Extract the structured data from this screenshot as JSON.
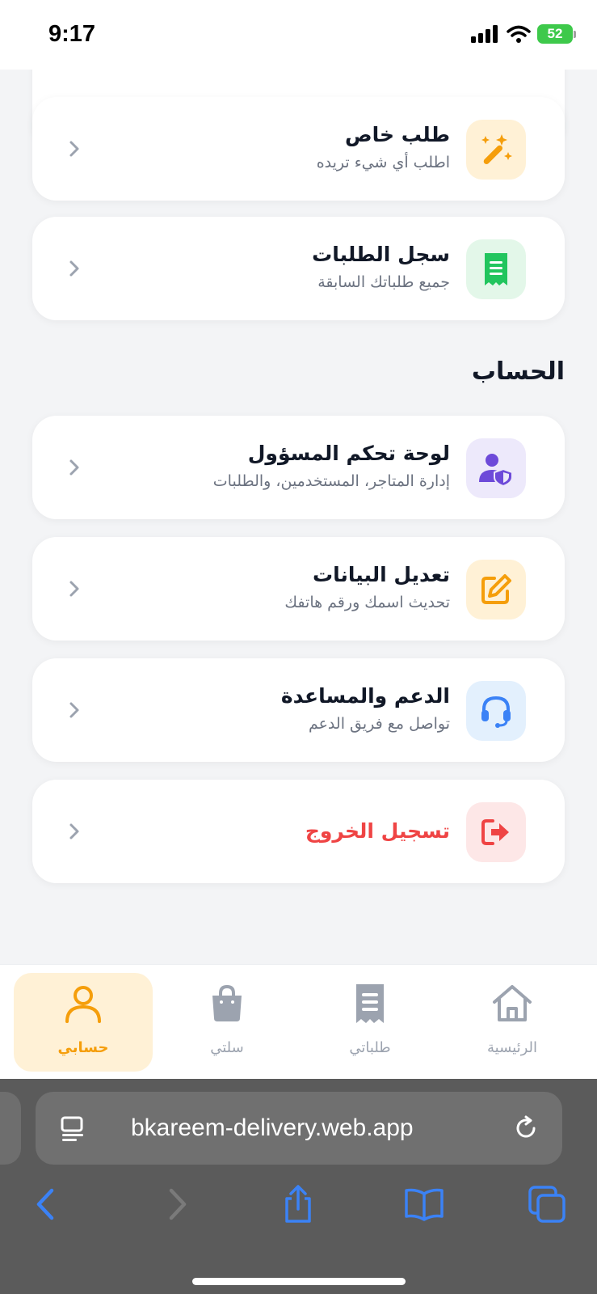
{
  "status_bar": {
    "time": "9:17",
    "battery": "52"
  },
  "menu_cards": [
    {
      "title": "طلب خاص",
      "subtitle": "اطلب أي شيء تريده",
      "icon": "magic-wand-icon",
      "tile_color": "#fff1d6",
      "icon_color": "#f59e0b"
    },
    {
      "title": "سجل الطلبات",
      "subtitle": "جميع طلباتك السابقة",
      "icon": "receipt-icon",
      "tile_color": "#e3f7e9",
      "icon_color": "#22c55e"
    }
  ],
  "account_section": {
    "title": "الحساب",
    "cards": [
      {
        "title": "لوحة تحكم المسؤول",
        "subtitle": "إدارة المتاجر، المستخدمين، والطلبات",
        "icon": "admin-shield-user-icon",
        "tile_color": "#ede9fb",
        "icon_color": "#6d4ad9"
      },
      {
        "title": "تعديل البيانات",
        "subtitle": "تحديث اسمك ورقم هاتفك",
        "icon": "edit-icon",
        "tile_color": "#fff1d6",
        "icon_color": "#f59e0b"
      },
      {
        "title": "الدعم والمساعدة",
        "subtitle": "تواصل مع فريق الدعم",
        "icon": "headset-icon",
        "tile_color": "#e3f0fd",
        "icon_color": "#3b82f6"
      },
      {
        "title": "تسجيل الخروج",
        "subtitle": "",
        "icon": "logout-icon",
        "tile_color": "#fde7e7",
        "icon_color": "#ef4444"
      }
    ]
  },
  "bottom_nav": [
    {
      "label": "حسابي",
      "icon": "user-icon",
      "active": true
    },
    {
      "label": "سلتي",
      "icon": "shopping-bag-icon",
      "active": false
    },
    {
      "label": "طلباتي",
      "icon": "receipt-icon",
      "active": false
    },
    {
      "label": "الرئيسية",
      "icon": "home-icon",
      "active": false
    }
  ],
  "browser": {
    "url": "bkareem-delivery.web.app"
  },
  "colors": {
    "accent": "#f59e0b",
    "danger": "#ef4444",
    "background": "#f3f4f6"
  }
}
